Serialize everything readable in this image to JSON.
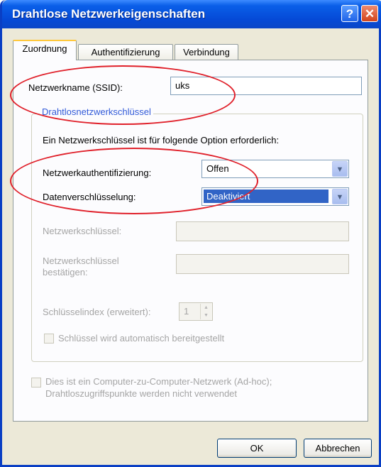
{
  "window": {
    "title": "Drahtlose Netzwerkeigenschaften",
    "help_glyph": "?",
    "close_glyph": "✕"
  },
  "tabs": [
    {
      "label": "Zuordnung",
      "active": true
    },
    {
      "label": "Authentifizierung",
      "active": false
    },
    {
      "label": "Verbindung",
      "active": false
    }
  ],
  "ssid": {
    "label": "Netzwerkname (SSID):",
    "value": "uks"
  },
  "group": {
    "legend": "Drahtlosnetzwerkschlüssel",
    "intro": "Ein Netzwerkschlüssel ist für folgende Option erforderlich:",
    "auth": {
      "label": "Netzwerkauthentifizierung:",
      "value": "Offen"
    },
    "encryption": {
      "label": "Datenverschlüsselung:",
      "value": "Deaktiviert"
    },
    "key": {
      "label": "Netzwerkschlüssel:"
    },
    "key_confirm": {
      "label_line1": "Netzwerkschlüssel",
      "label_line2": "bestätigen:"
    },
    "key_index": {
      "label": "Schlüsselindex (erweitert):",
      "value": "1"
    },
    "auto_key": {
      "label": "Schlüssel wird automatisch bereitgestellt"
    }
  },
  "adhoc": {
    "line1": "Dies ist ein Computer-zu-Computer-Netzwerk (Ad-hoc);",
    "line2": "Drahtloszugriffspunkte werden nicht verwendet"
  },
  "buttons": {
    "ok": "OK",
    "cancel": "Abbrechen"
  },
  "colors": {
    "title_bar": "#0a5fe8",
    "highlight_ellipse": "#e0202a",
    "selection": "#3164c6"
  }
}
